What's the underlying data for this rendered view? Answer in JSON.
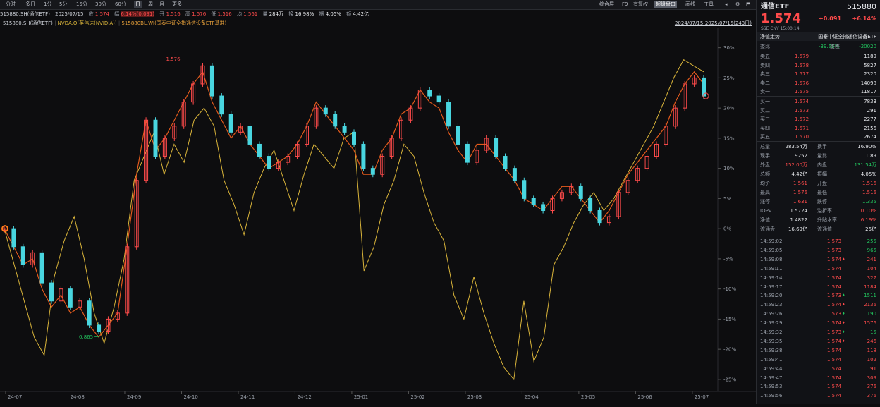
{
  "toolbar": {
    "periods": [
      "分时",
      "多日",
      "1分",
      "5分",
      "15分",
      "30分",
      "60分",
      "日",
      "周",
      "月",
      "更多"
    ],
    "active_period": "日",
    "right_tools": [
      "综合屏",
      "F9",
      "画线",
      "超级盘口",
      "画线",
      "工具"
    ],
    "right_tools_labels": [
      "综合屏",
      "F9",
      "有复权",
      "超级盘口",
      "画线",
      "工具"
    ]
  },
  "quote": {
    "code": "515880.SH(通信ETF)",
    "date": "2025/07/15",
    "close_label": "收",
    "close": "1.574",
    "change_label": "幅",
    "change": "6.14%(0.091)",
    "open_label": "开",
    "open": "1.516",
    "high_label": "高",
    "high": "1.576",
    "low_label": "低",
    "low": "1.516",
    "avg_label": "均",
    "avg": "1.561",
    "volume_label": "量",
    "volume": "284万",
    "turnover_label": "换",
    "turnover": "16.98%",
    "amplitude_label": "振",
    "amplitude": "4.05%",
    "amount_label": "额",
    "amount": "4.42亿"
  },
  "legend": {
    "s1": "515880.SH(通信ETF)",
    "s2": "NVDA.O(英伟达(NVIDIA))",
    "s3": "515880BL.WI(国泰中证全指通信设备ETF基准)",
    "range": "2024/07/15-2025/07/15(243日)"
  },
  "colors": {
    "up": "#ff4b4b",
    "down": "#49d6e0",
    "nvda": "#d9b43a",
    "bench": "#e25a1c",
    "bg": "#0d0d0f"
  },
  "chart_data": {
    "type": "line",
    "title": "",
    "x_ticks": [
      "24-07",
      "24-08",
      "24-09",
      "24-10",
      "24-11",
      "24-12",
      "25-01",
      "25-02",
      "25-03",
      "25-04",
      "25-05",
      "25-06",
      "25-07"
    ],
    "y_ticks": [
      "30%",
      "25%",
      "20%",
      "15%",
      "10%",
      "5%",
      "0%",
      "-5%",
      "-10%",
      "-15%",
      "-20%",
      "-25%"
    ],
    "ylim": [
      -27,
      33
    ],
    "annotations": [
      {
        "text": "1.576",
        "kind": "high"
      },
      {
        "text": "0.865",
        "kind": "low"
      }
    ],
    "series": [
      {
        "name": "515880.SH(通信ETF)",
        "kind": "candle",
        "values": [
          0,
          -3,
          -6,
          -4,
          -9,
          -12,
          -10,
          -13,
          -12,
          -16,
          -17,
          -15,
          -14,
          -3,
          8,
          18,
          12,
          15,
          17,
          21,
          24,
          27,
          22,
          19,
          16,
          17,
          14,
          12,
          10,
          11,
          12,
          14,
          17,
          20,
          19,
          17,
          16,
          14,
          10,
          9,
          12,
          15,
          18,
          20,
          23,
          22,
          21,
          17,
          14,
          11,
          13,
          15,
          12,
          10,
          8,
          5,
          4,
          3,
          5,
          6,
          7,
          5,
          3,
          1,
          2,
          6,
          8,
          10,
          12,
          14,
          17,
          20,
          24,
          25,
          22
        ]
      },
      {
        "name": "NVDA.O(英伟达(NVIDIA))",
        "kind": "line",
        "values": [
          0,
          -6,
          -12,
          -18,
          -21,
          -8,
          -2,
          2,
          -5,
          -14,
          -19,
          -13,
          -5,
          8,
          12,
          16,
          9,
          14,
          11,
          18,
          20,
          17,
          8,
          4,
          -1,
          6,
          10,
          13,
          8,
          3,
          9,
          14,
          12,
          10,
          15,
          16,
          -7,
          -3,
          4,
          8,
          14,
          12,
          6,
          1,
          -2,
          -11,
          -15,
          -8,
          -14,
          -19,
          -23,
          -25,
          -12,
          -22,
          -18,
          -6,
          -3,
          1,
          4,
          6,
          3,
          5,
          8,
          11,
          14,
          17,
          21,
          25,
          28,
          27,
          26
        ]
      },
      {
        "name": "515880BL.WI(国泰中证全指通信设备ETF基准)",
        "kind": "line",
        "values": [
          0,
          -3,
          -6,
          -5,
          -10,
          -13,
          -11,
          -14,
          -13,
          -16,
          -18,
          -16,
          -14,
          -3,
          9,
          18,
          13,
          15,
          18,
          21,
          24,
          26,
          21,
          18,
          15,
          17,
          14,
          12,
          10,
          11,
          12,
          14,
          17,
          21,
          19,
          17,
          15,
          13,
          9,
          9,
          13,
          15,
          19,
          20,
          23,
          21,
          20,
          16,
          13,
          11,
          14,
          14,
          12,
          10,
          8,
          5,
          4,
          3,
          5,
          7,
          7,
          5,
          3,
          1,
          3,
          6,
          9,
          11,
          13,
          15,
          17,
          21,
          24,
          26,
          24
        ]
      }
    ]
  },
  "panel": {
    "name": "通信ETF",
    "code": "515880",
    "price": "1.574",
    "change": "+0.091",
    "pct": "+6.14%",
    "sub": "SSE  CNY  15:00:14",
    "fund_label": "净值走势",
    "fund_name": "国泰中证全指通信设备ETF",
    "weibi_label": "委比",
    "weibi": "-39.66%",
    "weicha_label": "委差",
    "weicha": "-20020",
    "asks": [
      {
        "label": "卖五",
        "price": "1.579",
        "vol": "1189"
      },
      {
        "label": "卖四",
        "price": "1.578",
        "vol": "5827"
      },
      {
        "label": "卖三",
        "price": "1.577",
        "vol": "2320"
      },
      {
        "label": "卖二",
        "price": "1.576",
        "vol": "14098"
      },
      {
        "label": "卖一",
        "price": "1.575",
        "vol": "11817"
      }
    ],
    "bids": [
      {
        "label": "买一",
        "price": "1.574",
        "vol": "7833"
      },
      {
        "label": "买二",
        "price": "1.573",
        "vol": "291"
      },
      {
        "label": "买三",
        "price": "1.572",
        "vol": "2277"
      },
      {
        "label": "买四",
        "price": "1.571",
        "vol": "2156"
      },
      {
        "label": "买五",
        "price": "1.570",
        "vol": "2674"
      }
    ],
    "stats": [
      {
        "l1": "总量",
        "v1": "283.54万",
        "c1": "white",
        "l2": "换手",
        "v2": "16.90%",
        "c2": "white"
      },
      {
        "l1": "现手",
        "v1": "9252",
        "c1": "white",
        "l2": "量比",
        "v2": "1.89",
        "c2": "white"
      },
      {
        "l1": "外盘",
        "v1": "152.00万",
        "c1": "red",
        "l2": "内盘",
        "v2": "131.54万",
        "c2": "green"
      },
      {
        "l1": "总额",
        "v1": "4.42亿",
        "c1": "white",
        "l2": "振幅",
        "v2": "4.05%",
        "c2": "white"
      },
      {
        "l1": "均价",
        "v1": "1.561",
        "c1": "red",
        "l2": "开盘",
        "v2": "1.516",
        "c2": "red"
      },
      {
        "l1": "最高",
        "v1": "1.576",
        "c1": "red",
        "l2": "最低",
        "v2": "1.516",
        "c2": "red"
      },
      {
        "l1": "涨停",
        "v1": "1.631",
        "c1": "red",
        "l2": "跌停",
        "v2": "1.335",
        "c2": "green"
      },
      {
        "l1": "IOPV",
        "v1": "1.5724",
        "c1": "white",
        "l2": "溢折率",
        "v2": "0.10%",
        "c2": "red"
      },
      {
        "l1": "净值",
        "v1": "1.4822",
        "c1": "white",
        "l2": "升贴水率",
        "v2": "6.19%",
        "c2": "red"
      },
      {
        "l1": "流通盘",
        "v1": "16.69亿",
        "c1": "white",
        "l2": "流通值",
        "v2": "26亿",
        "c2": "white"
      }
    ],
    "ticks": [
      {
        "t": "14:59:02",
        "p": "1.573",
        "a": "",
        "v": "255",
        "vc": "green"
      },
      {
        "t": "14:59:05",
        "p": "1.573",
        "a": "",
        "v": "965",
        "vc": "green"
      },
      {
        "t": "14:59:08",
        "p": "1.574",
        "a": "♦",
        "v": "241",
        "vc": "red"
      },
      {
        "t": "14:59:11",
        "p": "1.574",
        "a": "",
        "v": "104",
        "vc": "red"
      },
      {
        "t": "14:59:14",
        "p": "1.574",
        "a": "",
        "v": "327",
        "vc": "red"
      },
      {
        "t": "14:59:17",
        "p": "1.574",
        "a": "",
        "v": "1184",
        "vc": "red"
      },
      {
        "t": "14:59:20",
        "p": "1.573",
        "a": "♦",
        "v": "1511",
        "vc": "green"
      },
      {
        "t": "14:59:23",
        "p": "1.574",
        "a": "♦",
        "v": "2136",
        "vc": "red"
      },
      {
        "t": "14:59:26",
        "p": "1.573",
        "a": "♦",
        "v": "190",
        "vc": "green"
      },
      {
        "t": "14:59:29",
        "p": "1.574",
        "a": "♦",
        "v": "1576",
        "vc": "red"
      },
      {
        "t": "14:59:32",
        "p": "1.573",
        "a": "♦",
        "v": "15",
        "vc": "green"
      },
      {
        "t": "14:59:35",
        "p": "1.574",
        "a": "♦",
        "v": "246",
        "vc": "red"
      },
      {
        "t": "14:59:38",
        "p": "1.574",
        "a": "",
        "v": "118",
        "vc": "red"
      },
      {
        "t": "14:59:41",
        "p": "1.574",
        "a": "",
        "v": "102",
        "vc": "red"
      },
      {
        "t": "14:59:44",
        "p": "1.574",
        "a": "",
        "v": "91",
        "vc": "red"
      },
      {
        "t": "14:59:47",
        "p": "1.574",
        "a": "",
        "v": "309",
        "vc": "red"
      },
      {
        "t": "14:59:53",
        "p": "1.574",
        "a": "",
        "v": "376",
        "vc": "red"
      },
      {
        "t": "14:59:56",
        "p": "1.574",
        "a": "",
        "v": "376",
        "vc": "red"
      }
    ]
  }
}
